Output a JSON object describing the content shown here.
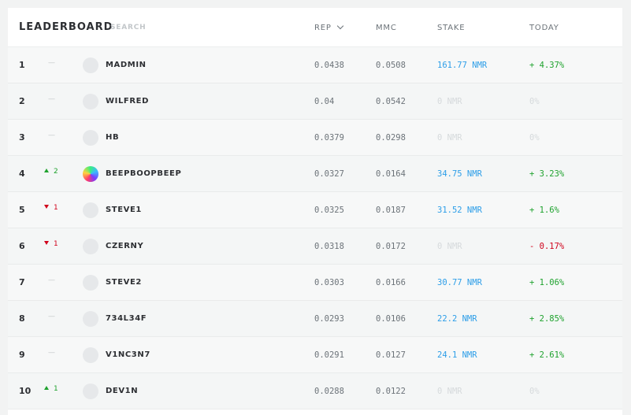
{
  "header": {
    "title": "LEADERBOARD",
    "search_placeholder": "SEARCH",
    "columns": {
      "rep": "REP",
      "mmc": "MMC",
      "stake": "STAKE",
      "today": "TODAY"
    }
  },
  "colors": {
    "positive": "#1fa22e",
    "negative": "#d0021b",
    "stake": "#2d9ee8",
    "muted": "#d6dadc"
  },
  "rows": [
    {
      "rank": "1",
      "change_dir": "none",
      "change": "",
      "avatar": "default-avatar-icon",
      "username": "MADMIN",
      "rep": "0.0438",
      "mmc": "0.0508",
      "stake": "161.77 NMR",
      "stake_state": "pos",
      "today": "+ 4.37%",
      "today_state": "pos"
    },
    {
      "rank": "2",
      "change_dir": "none",
      "change": "",
      "avatar": "default-avatar-icon",
      "username": "WILFRED",
      "rep": "0.04",
      "mmc": "0.0542",
      "stake": "0 NMR",
      "stake_state": "zero",
      "today": "0%",
      "today_state": "zero"
    },
    {
      "rank": "3",
      "change_dir": "none",
      "change": "",
      "avatar": "default-avatar-icon",
      "username": "HB",
      "rep": "0.0379",
      "mmc": "0.0298",
      "stake": "0 NMR",
      "stake_state": "zero",
      "today": "0%",
      "today_state": "zero"
    },
    {
      "rank": "4",
      "change_dir": "up",
      "change": "2",
      "avatar": "gradient-avatar-icon",
      "username": "BEEPBOOPBEEP",
      "rep": "0.0327",
      "mmc": "0.0164",
      "stake": "34.75 NMR",
      "stake_state": "pos",
      "today": "+ 3.23%",
      "today_state": "pos"
    },
    {
      "rank": "5",
      "change_dir": "down",
      "change": "1",
      "avatar": "default-avatar-icon",
      "username": "STEVE1",
      "rep": "0.0325",
      "mmc": "0.0187",
      "stake": "31.52 NMR",
      "stake_state": "pos",
      "today": "+ 1.6%",
      "today_state": "pos"
    },
    {
      "rank": "6",
      "change_dir": "down",
      "change": "1",
      "avatar": "default-avatar-icon",
      "username": "CZERNY",
      "rep": "0.0318",
      "mmc": "0.0172",
      "stake": "0 NMR",
      "stake_state": "zero",
      "today": "- 0.17%",
      "today_state": "neg"
    },
    {
      "rank": "7",
      "change_dir": "none",
      "change": "",
      "avatar": "default-avatar-icon",
      "username": "STEVE2",
      "rep": "0.0303",
      "mmc": "0.0166",
      "stake": "30.77 NMR",
      "stake_state": "pos",
      "today": "+ 1.06%",
      "today_state": "pos"
    },
    {
      "rank": "8",
      "change_dir": "none",
      "change": "",
      "avatar": "default-avatar-icon",
      "username": "734L34F",
      "rep": "0.0293",
      "mmc": "0.0106",
      "stake": "22.2 NMR",
      "stake_state": "pos",
      "today": "+ 2.85%",
      "today_state": "pos"
    },
    {
      "rank": "9",
      "change_dir": "none",
      "change": "",
      "avatar": "default-avatar-icon",
      "username": "V1NC3N7",
      "rep": "0.0291",
      "mmc": "0.0127",
      "stake": "24.1 NMR",
      "stake_state": "pos",
      "today": "+ 2.61%",
      "today_state": "pos"
    },
    {
      "rank": "10",
      "change_dir": "up",
      "change": "1",
      "avatar": "default-avatar-icon",
      "username": "DEV1N",
      "rep": "0.0288",
      "mmc": "0.0122",
      "stake": "0 NMR",
      "stake_state": "zero",
      "today": "0%",
      "today_state": "zero"
    }
  ]
}
